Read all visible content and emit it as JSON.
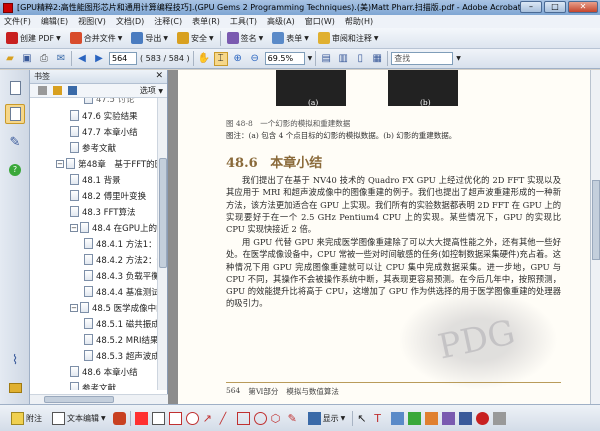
{
  "window": {
    "title": "[GPU精粹2:高性能图形芯片和通用计算编程技巧].(GPU Gems 2 Programming Techniques).(美)Matt Pharr.扫描版.pdf - Adobe Acrobat Professional"
  },
  "menu": [
    "文件(F)",
    "编辑(E)",
    "视图(V)",
    "文档(D)",
    "注释(C)",
    "表单(R)",
    "工具(T)",
    "高级(A)",
    "窗口(W)",
    "帮助(H)"
  ],
  "toolbar1": {
    "create_pdf": "创建 PDF",
    "merge_files": "合并文件",
    "export": "导出",
    "secure": "安全",
    "sign": "签名",
    "forms": "表单",
    "review_comment": "审阅和注释"
  },
  "toolbar2": {
    "page_number": "564",
    "page_count": "( 583 / 584 )",
    "zoom": "69.5%",
    "find_placeholder": "查找"
  },
  "bookmarks": {
    "title": "书签",
    "options": "选项",
    "items": [
      {
        "label": "47.6 实验结果",
        "level": 2
      },
      {
        "label": "47.7 本章小结",
        "level": 2
      },
      {
        "label": "参考文献",
        "level": 2
      },
      {
        "label": "第48章　基于FFT的医学",
        "level": 1,
        "expander": "−"
      },
      {
        "label": "48.1 背景",
        "level": 2
      },
      {
        "label": "48.2 傅里叶变换",
        "level": 2
      },
      {
        "label": "48.3 FFT算法",
        "level": 2
      },
      {
        "label": "48.4 在GPU上的实现",
        "level": 2,
        "expander": "−"
      },
      {
        "label": "48.4.1 方法1：主",
        "level": 3
      },
      {
        "label": "48.4.2 方法2：使",
        "level": 3
      },
      {
        "label": "48.4.3 负载平衡",
        "level": 3
      },
      {
        "label": "48.4.4 基准测试结",
        "level": 3
      },
      {
        "label": "48.5 医学成像中的FF",
        "level": 2,
        "expander": "−"
      },
      {
        "label": "48.5.1 磁共振成像",
        "level": 3
      },
      {
        "label": "48.5.2 MRI结果",
        "level": 3
      },
      {
        "label": "48.5.3 超声波成像",
        "level": 3
      },
      {
        "label": "48.6 本章小结",
        "level": 2
      },
      {
        "label": "参考文献",
        "level": 2
      }
    ]
  },
  "document": {
    "fig_label_a": "(a)",
    "fig_label_b": "(b)",
    "figure_caption": "图 48-8　一个幻影的模拟和重建数据",
    "figure_note": "图注：(a) 包含 4 个点目标的幻影的模拟数据。(b) 幻影的重建数据。",
    "section_number": "48.6",
    "section_title": "本章小结",
    "paragraph1": "我们提出了在基于 NV40 技术的 Quadro FX GPU 上经过优化的 2D FFT 实现以及其应用于 MRI 和超声波成像中的图像重建的例子。我们也提出了超声波重建形成的一种新方法，该方法更加适合在 GPU 上实现。我们所有的实验数据都表明 2D FFT 在 GPU 上的实现要好于在一个 2.5 GHz Pentium4 CPU 上的实现。某些情况下，GPU 的实现比 CPU 实现快接近 2 倍。",
    "paragraph2": "用 GPU 代替 GPU 来完成医学图像重建除了可以大大提高性能之外，还有其他一些好处。在医学成像设备中，CPU 常被一些对时间敏感的任务(如控制数据采集硬件)充占着。这种情况下用 GPU 完成图像重建就可以让 CPU 集中完成数据采集。进一步地，GPU 与 CPU 不同，其操作不会被操作系统中断，其表现更容易预测。在今后几年中，按照预测，GPU 的效能提升比将高于 CPU，这增加了 GPU 作为供选择的用于医学图像重建的处理器的吸引力。",
    "footer_page": "564",
    "footer_part": "第Ⅵ部分",
    "footer_section": "模拟与数值算法",
    "watermark": "PDG"
  },
  "toolbar3": {
    "attach": "附注",
    "text_edit": "文本编辑",
    "show": "显示"
  }
}
